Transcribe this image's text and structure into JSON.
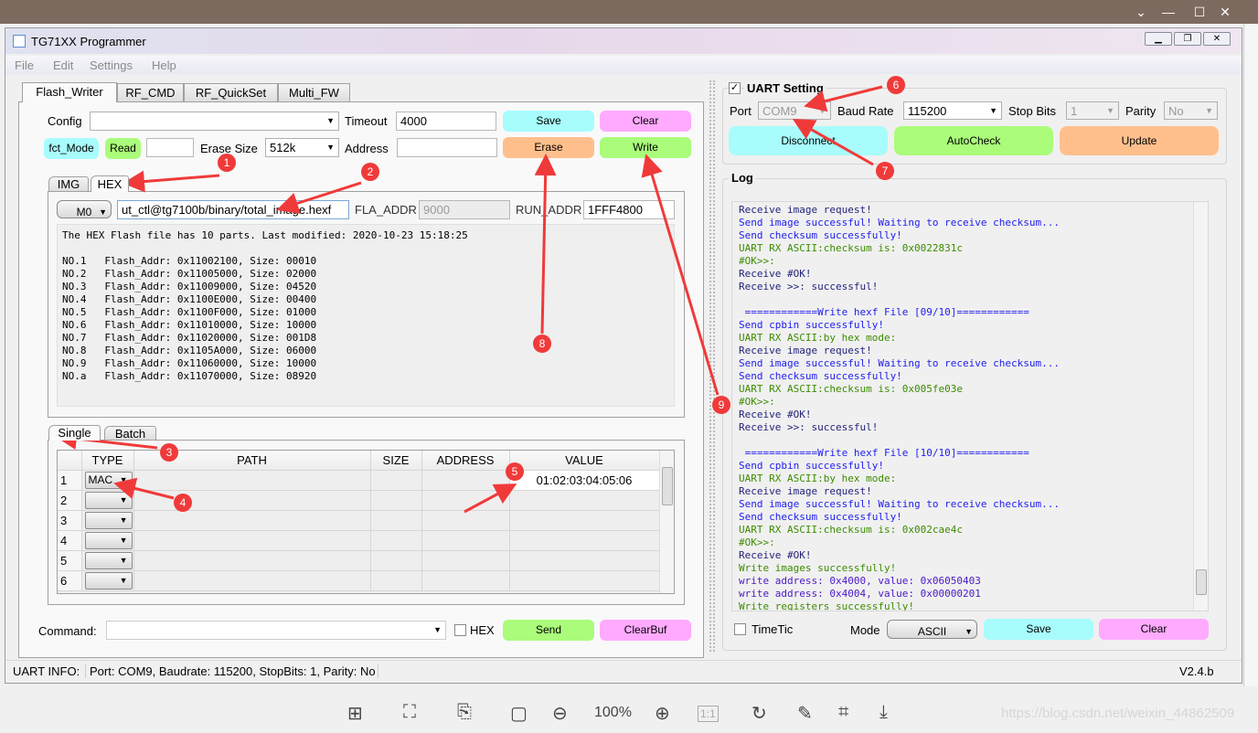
{
  "viewer": {
    "zoom": "100%",
    "watermark": "https://blog.csdn.net/weixin_44862509"
  },
  "window": {
    "title": "TG71XX Programmer"
  },
  "menu": [
    "File",
    "Edit",
    "Settings",
    "Help"
  ],
  "tabs": [
    "Flash_Writer",
    "RF_CMD",
    "RF_QuickSet",
    "Multi_FW"
  ],
  "flash": {
    "config_label": "Config",
    "config_value": "",
    "timeout_label": "Timeout",
    "timeout_value": "4000",
    "save": "Save",
    "clear": "Clear",
    "fct_mode": "fct_Mode",
    "read": "Read",
    "read_value": "",
    "erase_size_label": "Erase Size",
    "erase_size": "512k",
    "address_label": "Address",
    "address_value": "",
    "erase": "Erase",
    "write": "Write",
    "subtabs": [
      "IMG",
      "HEX"
    ],
    "mode": "M0",
    "path": "ut_ctl@tg7100b/binary/total_image.hexf",
    "fla_addr_label": "FLA_ADDR",
    "fla_addr": "9000",
    "run_addr_label": "RUN_ADDR",
    "run_addr": "1FFF4800",
    "info_lines": [
      "The HEX Flash file has 10 parts. Last modified: 2020-10-23 15:18:25",
      "",
      "NO.1   Flash_Addr: 0x11002100, Size: 00010",
      "NO.2   Flash_Addr: 0x11005000, Size: 02000",
      "NO.3   Flash_Addr: 0x11009000, Size: 04520",
      "NO.4   Flash_Addr: 0x1100E000, Size: 00400",
      "NO.5   Flash_Addr: 0x1100F000, Size: 01000",
      "NO.6   Flash_Addr: 0x11010000, Size: 10000",
      "NO.7   Flash_Addr: 0x11020000, Size: 001D8",
      "NO.8   Flash_Addr: 0x1105A000, Size: 06000",
      "NO.9   Flash_Addr: 0x11060000, Size: 10000",
      "NO.a   Flash_Addr: 0x11070000, Size: 08920"
    ],
    "modetabs": [
      "Single",
      "Batch"
    ],
    "table": {
      "headers": [
        "TYPE",
        "PATH",
        "SIZE",
        "ADDRESS",
        "VALUE"
      ],
      "rows": [
        {
          "n": "1",
          "type": "MAC",
          "value": "01:02:03:04:05:06"
        },
        {
          "n": "2",
          "type": "",
          "value": ""
        },
        {
          "n": "3",
          "type": "",
          "value": ""
        },
        {
          "n": "4",
          "type": "",
          "value": ""
        },
        {
          "n": "5",
          "type": "",
          "value": ""
        },
        {
          "n": "6",
          "type": "",
          "value": ""
        }
      ]
    },
    "command_label": "Command:",
    "command_value": "",
    "hex_label": "HEX",
    "send": "Send",
    "clearbuf": "ClearBuf"
  },
  "status": {
    "info_label": "UART INFO:",
    "info": "Port: COM9, Baudrate: 115200, StopBits: 1, Parity: No",
    "version": "V2.4.b"
  },
  "uart": {
    "title": "UART Setting",
    "checked": true,
    "port_label": "Port",
    "port": "COM9",
    "baud_label": "Baud Rate",
    "baud": "115200",
    "stop_label": "Stop Bits",
    "stop": "1",
    "parity_label": "Parity",
    "parity": "No",
    "disconnect": "Disconnect",
    "autocheck": "AutoCheck",
    "update": "Update"
  },
  "log": {
    "title": "Log",
    "lines": [
      {
        "t": "Receive image request!",
        "c": "navy"
      },
      {
        "t": "Send image successful! Waiting to receive checksum...",
        "c": "blue"
      },
      {
        "t": "Send checksum successfully!",
        "c": "blue"
      },
      {
        "t": "UART RX ASCII:checksum is: 0x0022831c",
        "c": "green"
      },
      {
        "t": "#OK>>:",
        "c": "green"
      },
      {
        "t": "Receive #OK!",
        "c": "navy"
      },
      {
        "t": "Receive >>: successful!",
        "c": "navy"
      },
      {
        "t": "",
        "c": "navy"
      },
      {
        "t": " ============Write hexf File [09/10]============",
        "c": "blue"
      },
      {
        "t": "Send cpbin successfully!",
        "c": "blue"
      },
      {
        "t": "UART RX ASCII:by hex mode:",
        "c": "green"
      },
      {
        "t": "Receive image request!",
        "c": "navy"
      },
      {
        "t": "Send image successful! Waiting to receive checksum...",
        "c": "blue"
      },
      {
        "t": "Send checksum successfully!",
        "c": "blue"
      },
      {
        "t": "UART RX ASCII:checksum is: 0x005fe03e",
        "c": "green"
      },
      {
        "t": "#OK>>:",
        "c": "green"
      },
      {
        "t": "Receive #OK!",
        "c": "navy"
      },
      {
        "t": "Receive >>: successful!",
        "c": "navy"
      },
      {
        "t": "",
        "c": "navy"
      },
      {
        "t": " ============Write hexf File [10/10]============",
        "c": "blue"
      },
      {
        "t": "Send cpbin successfully!",
        "c": "blue"
      },
      {
        "t": "UART RX ASCII:by hex mode:",
        "c": "green"
      },
      {
        "t": "Receive image request!",
        "c": "navy"
      },
      {
        "t": "Send image successful! Waiting to receive checksum...",
        "c": "blue"
      },
      {
        "t": "Send checksum successfully!",
        "c": "blue"
      },
      {
        "t": "UART RX ASCII:checksum is: 0x002cae4c",
        "c": "green"
      },
      {
        "t": "#OK>>:",
        "c": "green"
      },
      {
        "t": "Receive #OK!",
        "c": "navy"
      },
      {
        "t": "Write images successfully!",
        "c": "green"
      },
      {
        "t": "write address: 0x4000, value: 0x06050403",
        "c": "purple"
      },
      {
        "t": "write address: 0x4004, value: 0x00000201",
        "c": "purple"
      },
      {
        "t": "Write registers successfully!",
        "c": "green"
      }
    ],
    "timetic_label": "TimeTic",
    "mode_label": "Mode",
    "mode": "ASCII",
    "save": "Save",
    "clear": "Clear"
  },
  "annotations": [
    "1",
    "2",
    "3",
    "4",
    "5",
    "6",
    "7",
    "8",
    "9"
  ],
  "colors": {
    "cyan": "#a8fcfc",
    "pink": "#ffaaff",
    "orange": "#ffbf8c",
    "green": "#aafc7a",
    "annotation": "#f03a3a"
  }
}
